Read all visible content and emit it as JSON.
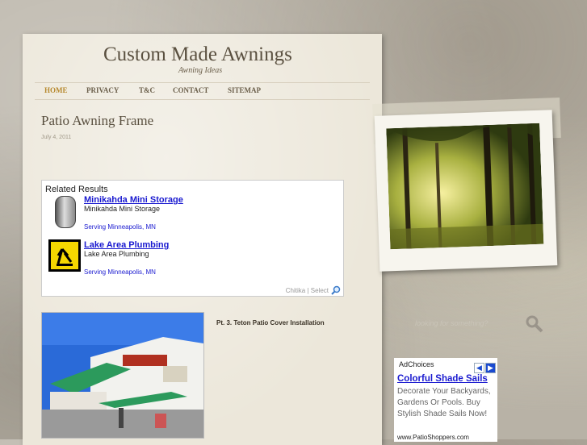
{
  "site": {
    "title": "Custom Made Awnings",
    "tagline": "Awning Ideas"
  },
  "nav": {
    "items": [
      {
        "label": "HOME"
      },
      {
        "label": "PRIVACY"
      },
      {
        "label": "T&C"
      },
      {
        "label": "CONTACT"
      },
      {
        "label": "SITEMAP"
      }
    ],
    "active": "HOME"
  },
  "post": {
    "title": "Patio Awning Frame",
    "date": "July 4, 2011"
  },
  "related": {
    "header": "Related Results",
    "items": [
      {
        "title": "Minikahda Mini Storage",
        "subtitle": "Minikahda Mini Storage",
        "location": "Serving Minneapolis, MN"
      },
      {
        "title": "Lake Area Plumbing",
        "subtitle": "Lake Area Plumbing",
        "location": "Serving Minneapolis, MN"
      }
    ],
    "footer": "Chitika | Select"
  },
  "content": {
    "caption": "Pt. 3. Teton Patio Cover Installation"
  },
  "sidebar": {
    "search_placeholder": "looking for something?"
  },
  "ad": {
    "choices": "AdChoices",
    "title": "Colorful Shade Sails",
    "body": "Decorate Your Backyards, Gardens Or Pools. Buy Stylish Shade Sails Now!",
    "url": "www.PatioShoppers.com"
  },
  "colors": {
    "link": "#1a1ad0",
    "nav_active": "#b7892e",
    "paper": "#ece7da"
  }
}
